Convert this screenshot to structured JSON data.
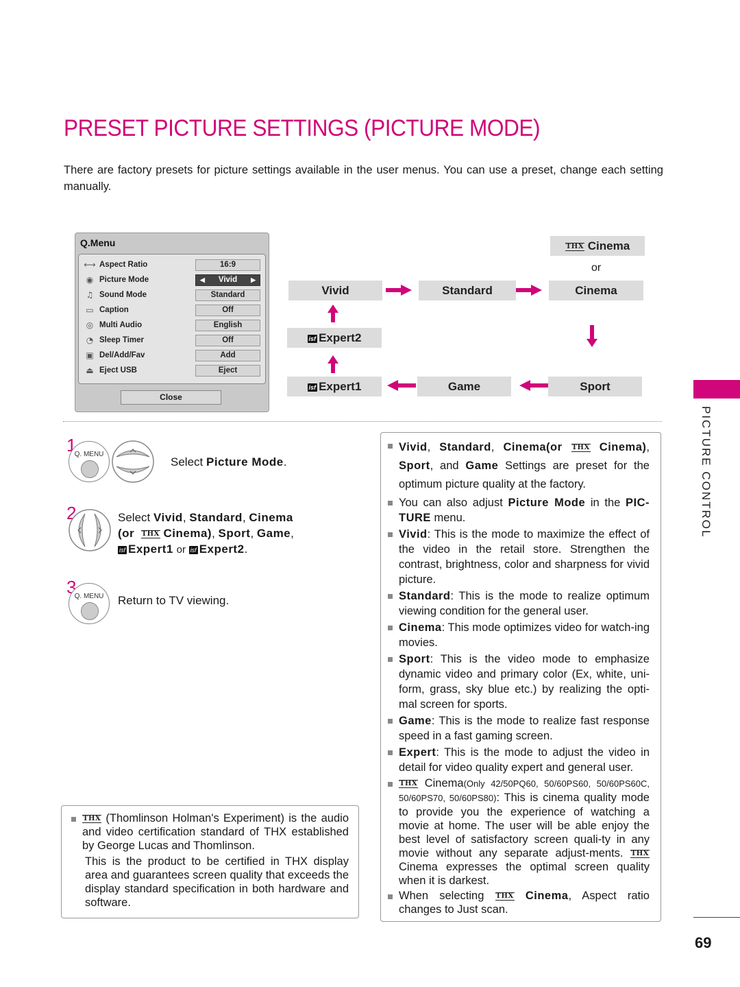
{
  "title": "PRESET PICTURE SETTINGS (PICTURE MODE)",
  "intro": "There are factory presets for picture settings available in the user menus. You can use a preset, change each setting manually.",
  "colors": {
    "accent": "#d0067a",
    "menu_bg": "#c9c9c9",
    "node_bg": "#dcdcdc"
  },
  "qmenu": {
    "title": "Q.Menu",
    "rows": [
      {
        "icon": "aspect-ratio-icon",
        "label": "Aspect Ratio",
        "value": "16:9",
        "selected": false
      },
      {
        "icon": "eye-icon",
        "label": "Picture Mode",
        "value": "Vivid",
        "selected": true
      },
      {
        "icon": "music-note-icon",
        "label": "Sound Mode",
        "value": "Standard",
        "selected": false
      },
      {
        "icon": "caption-icon",
        "label": "Caption",
        "value": "Off",
        "selected": false
      },
      {
        "icon": "multi-audio-icon",
        "label": "Multi Audio",
        "value": "English",
        "selected": false
      },
      {
        "icon": "sleep-timer-icon",
        "label": "Sleep Timer",
        "value": "Off",
        "selected": false
      },
      {
        "icon": "channel-icon",
        "label": "Del/Add/Fav",
        "value": "Add",
        "selected": false
      },
      {
        "icon": "eject-usb-icon",
        "label": "Eject USB",
        "value": "Eject",
        "selected": false
      }
    ],
    "close_label": "Close"
  },
  "flow": {
    "thx_cinema": "Cinema",
    "or": "or",
    "vivid": "Vivid",
    "standard": "Standard",
    "cinema": "Cinema",
    "expert2": "Expert2",
    "expert1": "Expert1",
    "game": "Game",
    "sport": "Sport",
    "isf_badge": "isf",
    "thx_badge": "THX"
  },
  "steps": [
    {
      "num": "1",
      "button": "Q. MENU",
      "pre": "Select ",
      "bold": "Picture Mode",
      "post": "."
    },
    {
      "num": "2",
      "l1_pre": "Select ",
      "l1_b1": "Vivid",
      "l1_b2": "Standard",
      "l1_b3": "Cinema",
      "l2_b1": "(or",
      "l2_b2": "Cinema)",
      "l2_b3": "Sport",
      "l2_b4": "Game",
      "l3_b1": "Expert1",
      "l3_or": "or",
      "l3_b2": "Expert2"
    },
    {
      "num": "3",
      "button": "Q. MENU",
      "text": "Return to TV viewing."
    }
  ],
  "notes": {
    "n1_b1": "Vivid",
    "n1_b2": "Standard",
    "n1_b3": "Cinema(or",
    "n1_b4": "Cinema)",
    "n1_b5": "Sport",
    "n1_and": "and",
    "n1_b6": "Game",
    "n1_rest": " Settings are preset for the optimum picture quality at the factory.",
    "n2_pre": "You can also adjust ",
    "n2_b1": "Picture Mode",
    "n2_mid": " in the ",
    "n2_b2": "PIC-TURE",
    "n2_post": " menu.",
    "n3_b": "Vivid",
    "n3": ": This is the mode to maximize the effect of the video in the retail store. Strengthen the contrast, brightness, color and sharpness for vivid picture.",
    "n4_b": "Standard",
    "n4": ": This is the mode to realize optimum viewing condition for the general user.",
    "n5_b": "Cinema",
    "n5": ": This mode optimizes video for watch-ing movies.",
    "n6_b": "Sport",
    "n6": ": This is the video mode to emphasize dynamic video and primary color (Ex, white, uni-form, grass, sky blue etc.) by realizing the opti-mal screen for sports.",
    "n7_b": "Game",
    "n7": ": This is the mode to realize fast response speed in a fast gaming screen.",
    "n8_b": "Expert",
    "n8": ": This is the mode to adjust the video in detail for video quality expert and general user.",
    "n9_cinema": "Cinema",
    "n9_models": "(Only 42/50PQ60, 50/60PS60, 50/60PS60C, 50/60PS70, 50/60PS80)",
    "n9_rest": ": This is cinema quality mode to provide you the experience of watching a movie at home. The user will be able enjoy the best level of satisfactory screen quali-ty in any movie without any separate adjust-ments.",
    "n9_cinema2": "Cinema",
    "n9_rest2": " expresses the optimal screen quality when it is darkest.",
    "n10_pre": "When selecting ",
    "n10_b": "Cinema",
    "n10_post": ", Aspect ratio changes to Just scan."
  },
  "thx_note": {
    "p1": " (Thomlinson Holman's Experiment) is the audio and video certification standard of THX established by George Lucas and Thomlinson.",
    "p2": "This is the product to be certified in THX display area and guarantees screen quality that exceeds the display standard specification in both hardware and software."
  },
  "side_label": "PICTURE CONTROL",
  "page_number": "69"
}
